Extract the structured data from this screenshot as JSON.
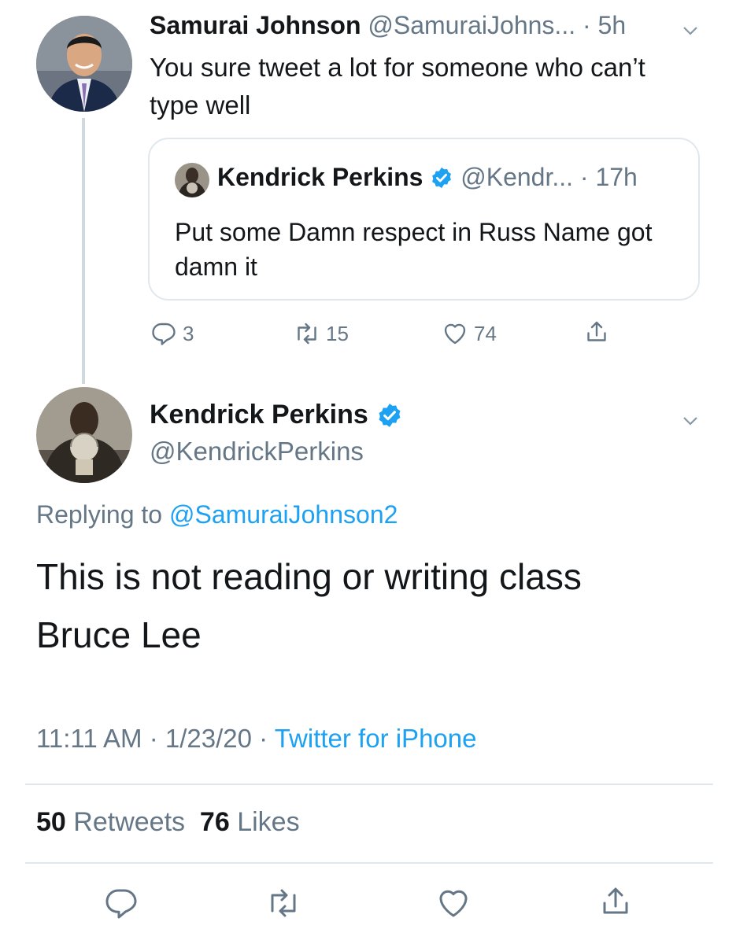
{
  "tweet1": {
    "name": "Samurai Johnson",
    "handle": "@SamuraiJohns...",
    "sep": "·",
    "time": "5h",
    "text": "You sure tweet a lot for someone who can’t type well",
    "quote": {
      "name": "Kendrick Perkins",
      "handle": "@Kendr...",
      "sep": "·",
      "time": "17h",
      "text": "Put some Damn respect in Russ Name got damn it"
    },
    "actions": {
      "replies": "3",
      "retweets": "15",
      "likes": "74"
    }
  },
  "tweet2": {
    "name": "Kendrick Perkins",
    "handle": "@KendrickPerkins",
    "replying_prefix": "Replying to",
    "replying_to": "@SamuraiJohnson2",
    "text_line1": "This is not reading or writing class",
    "text_line2": "Bruce Lee",
    "timestamp": "11:11 AM · 1/23/20 ·",
    "source": "Twitter for iPhone",
    "retweet_count": "50",
    "retweet_label": "Retweets",
    "like_count": "76",
    "like_label": "Likes"
  },
  "colors": {
    "accent": "#1da1f2",
    "muted": "#657786",
    "border": "#e1e8ed",
    "text": "#14171a"
  },
  "icons": [
    "chevron-down-icon",
    "verified-badge-icon",
    "reply-icon",
    "retweet-icon",
    "like-icon",
    "share-icon"
  ]
}
